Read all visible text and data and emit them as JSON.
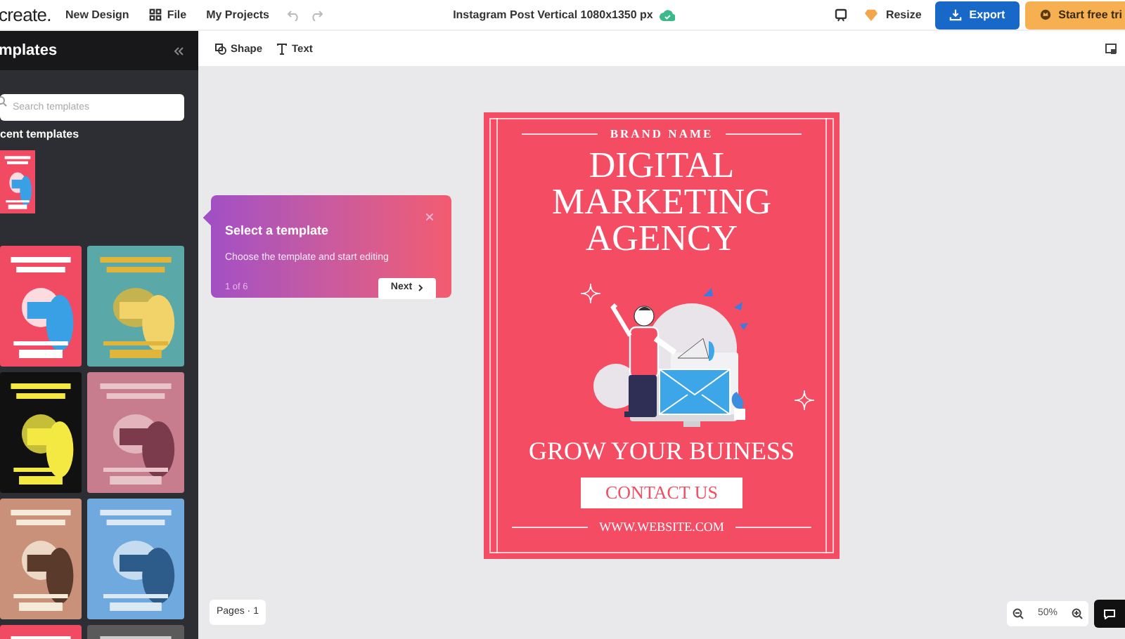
{
  "topbar": {
    "logo": "create.",
    "menu": [
      "New Design",
      "File",
      "My Projects"
    ],
    "title": "Instagram Post Vertical 1080x1350 px",
    "resize": "Resize",
    "export": "Export",
    "trial": "Start free tri"
  },
  "toolbar": [
    "Shape",
    "Text"
  ],
  "sidebar": {
    "title": "mplates",
    "search": {
      "placeholder": "Search templates"
    },
    "recent_heading": "cent templates"
  },
  "tooltip": {
    "title": "Select a template",
    "text": "Choose the template and start editing",
    "step": "1 of 6",
    "next": "Next"
  },
  "design": {
    "brand": "BRAND NAME",
    "headline": [
      "DIGITAL",
      "MARKETING",
      "AGENCY"
    ],
    "tagline": "GROW YOUR BUINESS",
    "cta": "CONTACT US",
    "website": "WWW.WEBSITE.COM"
  },
  "pages": "Pages · 1",
  "zoom": "50%"
}
